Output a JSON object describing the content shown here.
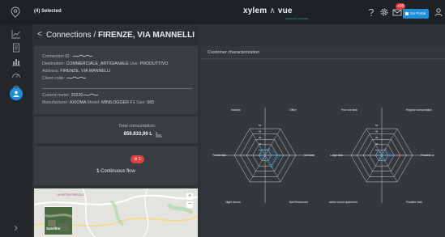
{
  "header": {
    "selection_label": "(4) Selected",
    "brand": "xylem",
    "brand_product": "vue",
    "brand_sub": "powered by GoAigua",
    "mail_badge": "+99",
    "go_portal_label": "Go Portal"
  },
  "page": {
    "back_symbol": "<",
    "breadcrumb": "Connections /",
    "connection_name": "FIRENZE, VIA MANNELLI"
  },
  "info": {
    "connection_id_label": "Connection ID:",
    "destination_label": "Destination:",
    "destination_value": "COMMERCIALE_ARTIGIANALE",
    "use_label": "Use:",
    "use_value": "PRODUTTIVO",
    "address_label": "Address:",
    "address_value": "FIRENZE, VIA MANNELLI",
    "client_code_label": "Client code:",
    "current_meter_label": "Current meter:",
    "current_meter_value": "20220",
    "manufacturer_label": "Manufacturer:",
    "manufacturer_value": "AXIOMA",
    "model_label": "Model:",
    "model_value": "MINILOGGER F1",
    "size_label": "Size:",
    "size_value": "065"
  },
  "consumption": {
    "label": "Total consumption:",
    "value": "859.833,99 L"
  },
  "flow": {
    "badge": "1",
    "count": "1",
    "label": "Continuous flow"
  },
  "map": {
    "satellite_label": "Satellite",
    "zoom_in": "+",
    "zoom_out": "−",
    "place": "LA PIETRA-FIESOLE"
  },
  "characterization": {
    "title": "Customer characterization",
    "radar_left": {
      "axes": [
        "Industry",
        "Office",
        "Services",
        "Bar/Restaurant",
        "Night leisure",
        "Residential"
      ],
      "ticks": [
        "50",
        "40",
        "30",
        "20",
        "10"
      ],
      "values": [
        10,
        12,
        24,
        22,
        6,
        8
      ],
      "color": "#2b9bd4"
    },
    "radar_right": {
      "axes": [
        "Few use leak",
        "Regular consumption",
        "Possible profi...",
        "Possible leak",
        "Possible tourist apartment",
        "Large leak"
      ],
      "ticks": [
        "50",
        "40",
        "30",
        "20",
        "10"
      ],
      "values": [
        6,
        12,
        16,
        10,
        6,
        7
      ],
      "color": "#2b9bd4"
    }
  },
  "colors": {
    "accent": "#1e8fd9",
    "alert": "#e04141",
    "background": "#2e3135",
    "card": "#3a3e43"
  }
}
